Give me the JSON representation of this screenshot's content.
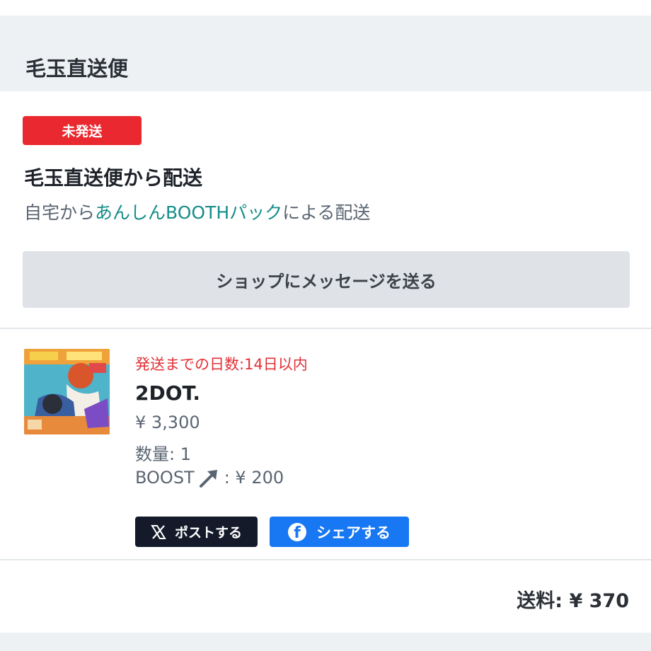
{
  "section": {
    "title": "毛玉直送便"
  },
  "shipping": {
    "status_badge": "未発送",
    "method_title": "毛玉直送便から配送",
    "desc_prefix": "自宅から",
    "desc_link": "あんしんBOOTHパック",
    "desc_suffix": "による配送",
    "message_button": "ショップにメッセージを送る"
  },
  "item": {
    "ship_days": "発送までの日数:14日以内",
    "name": "2DOT.",
    "price": "¥ 3,300",
    "quantity": "数量: 1",
    "boost_label": "BOOST",
    "boost_value": ": ¥ 200"
  },
  "share": {
    "x_label": "ポストする",
    "facebook_label": "シェアする"
  },
  "footer": {
    "shipping_fee": "送料: ¥ 370"
  },
  "colors": {
    "badge": "#e9292f",
    "link": "#168d89",
    "ship_days": "#e23036",
    "x_button": "#141a2a",
    "facebook_button": "#1877f2"
  }
}
